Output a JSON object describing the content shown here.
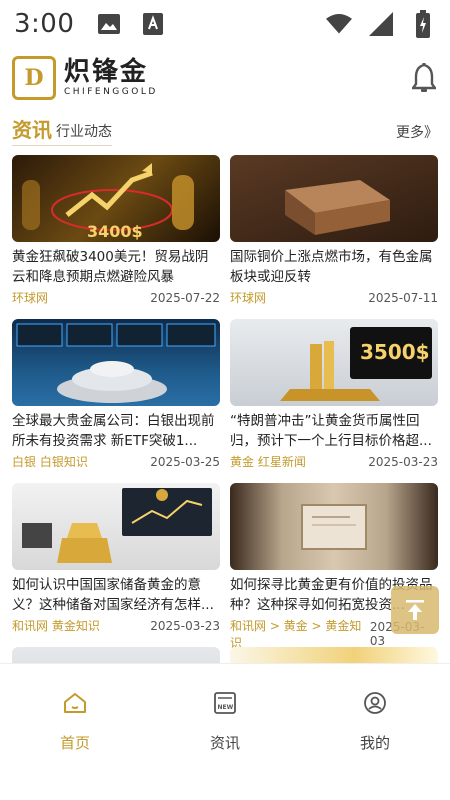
{
  "status_bar": {
    "time": "3:00"
  },
  "header": {
    "logo_mark": "D",
    "logo_cn": "炽锋金",
    "logo_en": "CHIFENGGOLD"
  },
  "section": {
    "title": "资讯",
    "subtitle": "行业动态",
    "more": "更多》"
  },
  "articles": [
    {
      "title": "黄金狂飙破3400美元！贸易战阴云和降息预期点燃避险风暴",
      "source": "环球网",
      "date": "2025-07-22",
      "image": "gold-chart-3400"
    },
    {
      "title": "国际铜价上涨点燃市场，有色金属板块或迎反转",
      "source": "环球网",
      "date": "2025-07-11",
      "image": "copper-ingot"
    },
    {
      "title": "全球最大贵金属公司：白银出现前所未有投资需求 新ETF突破1...",
      "source": "白银 白银知识",
      "date": "2025-03-25",
      "image": "silver-trading-floor"
    },
    {
      "title": "“特朗普冲击”让黄金货币属性回归，预计下一个上行目标价格超...",
      "source": "黄金 红星新闻",
      "date": "2025-03-23",
      "image": "gold-bars-3500"
    },
    {
      "title": "如何认识中国国家储备黄金的意义？这种储备对国家经济有怎样...",
      "source": "和讯网  黄金知识",
      "date": "2025-03-23",
      "image": "gold-office"
    },
    {
      "title": "如何探寻比黄金更有价值的投资品种？这种探寻如何拓宽投资...",
      "source": "和讯网 > 黄金 > 黄金知识",
      "date": "2025-03-03",
      "image": "blank-frame"
    }
  ],
  "tabs": [
    {
      "label": "首页",
      "icon": "home-icon",
      "active": true
    },
    {
      "label": "资讯",
      "icon": "news-icon",
      "active": false
    },
    {
      "label": "我的",
      "icon": "user-icon",
      "active": false
    }
  ],
  "colors": {
    "accent": "#c49a2c",
    "text": "#222222"
  }
}
